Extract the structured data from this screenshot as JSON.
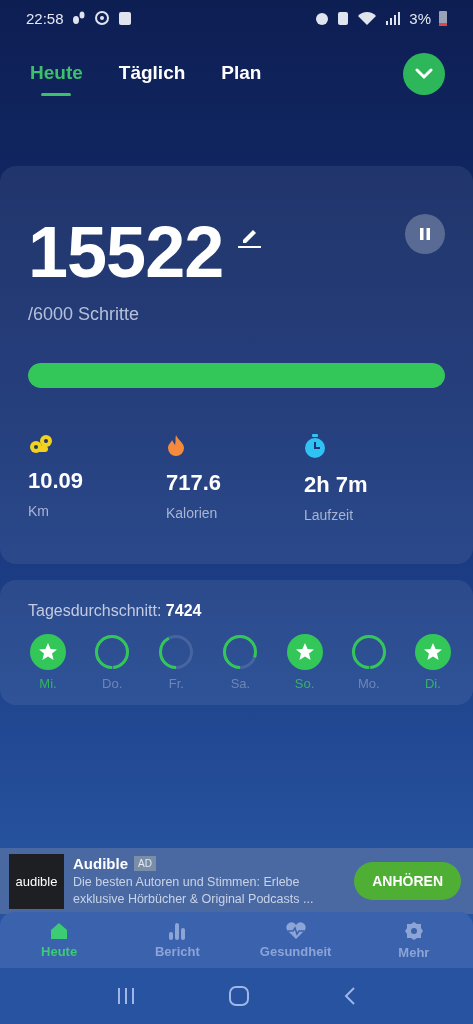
{
  "status_bar": {
    "time": "22:58",
    "battery": "3%"
  },
  "tabs": [
    {
      "label": "Heute",
      "selected": true
    },
    {
      "label": "Täglich",
      "selected": false
    },
    {
      "label": "Plan",
      "selected": false
    }
  ],
  "steps": {
    "count": "15522",
    "goal": "/6000 Schritte",
    "level": 1,
    "paused": false
  },
  "stats": [
    {
      "kind": "distance",
      "value": "10.09",
      "unit": "Km"
    },
    {
      "kind": "calories",
      "value": "717.6",
      "unit": "Kalorien"
    },
    {
      "kind": "time",
      "value": "2h 7m",
      "unit": "Laufzeit"
    }
  ],
  "average": {
    "label": "Tagesdurchschnitt:",
    "value": "7424"
  },
  "days": [
    {
      "label": "Mi.",
      "achieved": true
    },
    {
      "label": "Do.",
      "achieved": false
    },
    {
      "label": "Fr.",
      "achieved": false
    },
    {
      "label": "Sa.",
      "achieved": false
    },
    {
      "label": "So.",
      "achieved": true
    },
    {
      "label": "Mo.",
      "achieved": false
    },
    {
      "label": "Di.",
      "achieved": true
    }
  ],
  "ad": {
    "logo_text": "audible",
    "title": "Audible",
    "badge": "AD",
    "text": "Die besten Autoren und Stimmen: Erlebe exklusive Hörbücher & Original Podcasts ...",
    "button": "ANHÖREN"
  },
  "bottom_nav": [
    {
      "label": "Heute",
      "kind": "home",
      "selected": true
    },
    {
      "label": "Bericht",
      "kind": "report",
      "selected": false
    },
    {
      "label": "Gesundheit",
      "kind": "health",
      "selected": false
    },
    {
      "label": "Mehr",
      "kind": "more",
      "selected": false
    }
  ]
}
